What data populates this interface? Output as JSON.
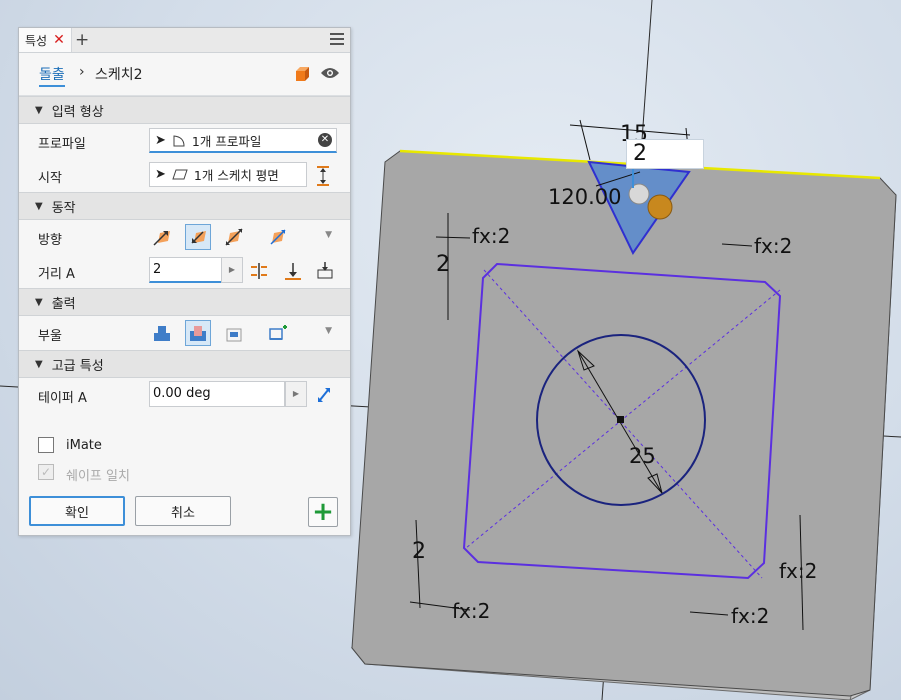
{
  "panel": {
    "tab_label": "특성",
    "tab_close": "✕",
    "tab_add": "+",
    "breadcrumb": {
      "parent": "돌출",
      "separator": "›",
      "current": "스케치2"
    },
    "sections": {
      "input": "입력 형상",
      "behavior": "동작",
      "output": "출력",
      "advanced": "고급 특성"
    },
    "profile": {
      "label": "프로파일",
      "value": "1개 프로파일"
    },
    "start": {
      "label": "시작",
      "value": "1개 스케치 평면"
    },
    "direction": {
      "label": "방향"
    },
    "distance": {
      "label": "거리 A",
      "value": "2"
    },
    "boolean": {
      "label": "부울"
    },
    "taper": {
      "label": "테이퍼 A",
      "value": "0.00 deg"
    },
    "imate": {
      "label": "iMate",
      "checked": false
    },
    "match_shape": {
      "label": "쉐이프 일치",
      "checked": true,
      "enabled": false
    },
    "ok_label": "확인",
    "cancel_label": "취소"
  },
  "viewport": {
    "dims": {
      "top_15": "15",
      "angle": "120.00",
      "edit_value": "2",
      "fx_top_left": "fx:2",
      "fx_top_right": "fx:2",
      "left_2_top": "2",
      "circle_dia": "25",
      "left_2_bottom": "2",
      "fx_bottom_left": "fx:2",
      "fx_bottom_right": "fx:2",
      "fx_right": "fx:2"
    }
  },
  "colors": {
    "accent": "#3d8fd8",
    "sketch_blue": "#5b2fe0",
    "circle": "#1a237e",
    "highlight_edge": "#e8e800",
    "plate_face": "#a7a7a7"
  }
}
